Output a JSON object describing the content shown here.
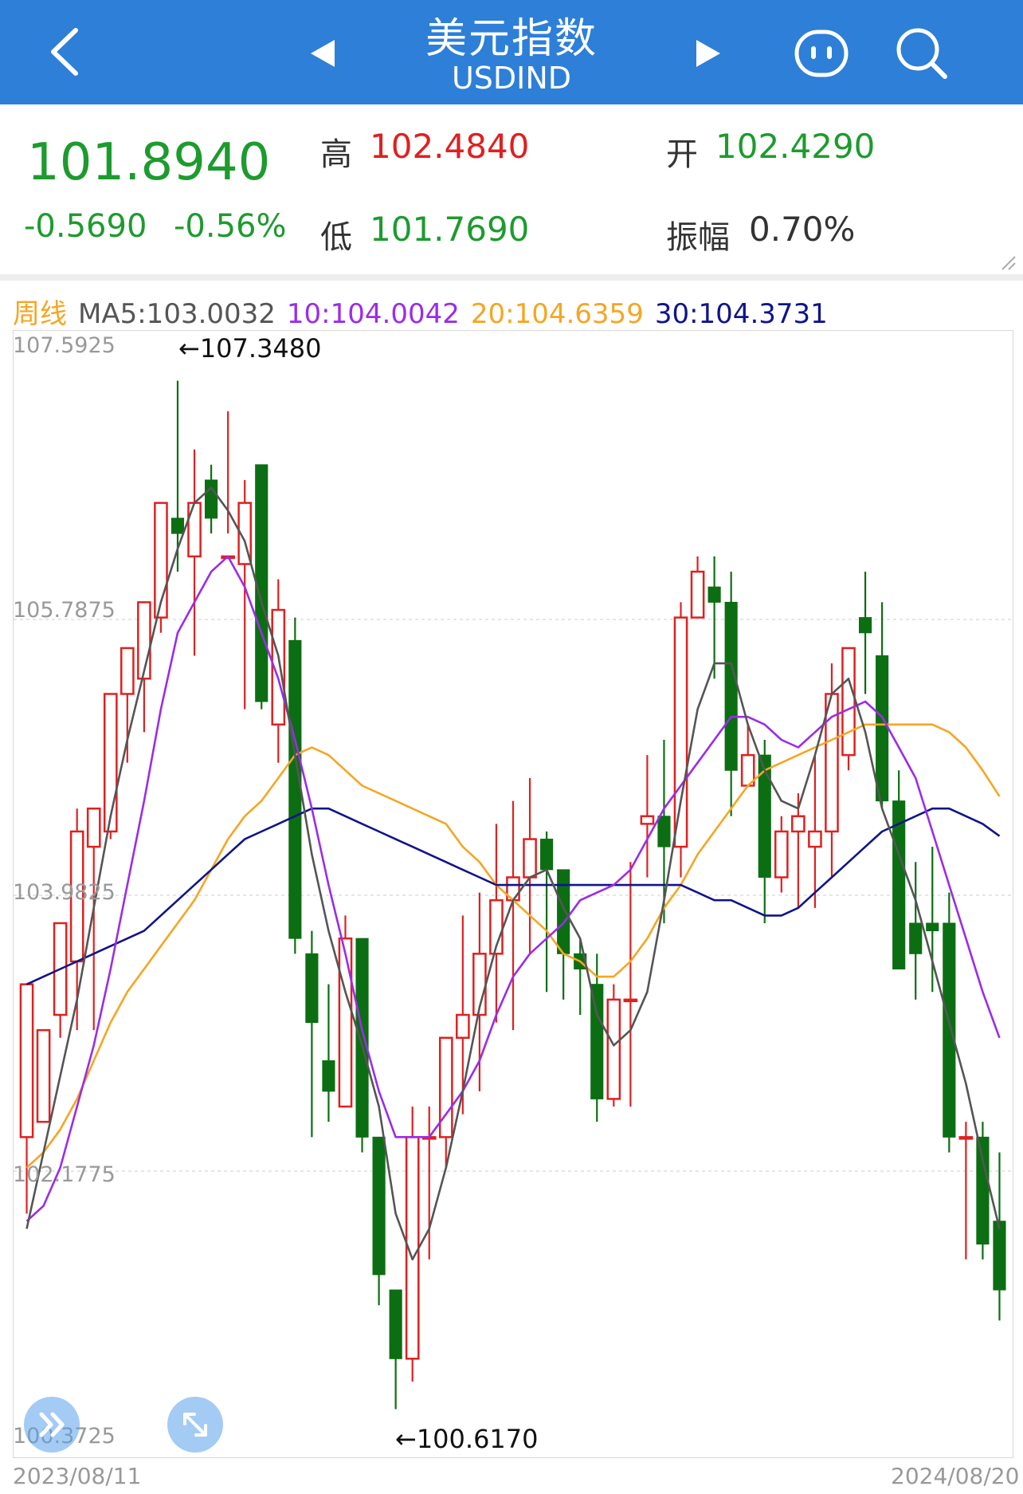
{
  "header": {
    "title": "美元指数",
    "symbol": "USDIND",
    "back_icon": "back-arrow-icon",
    "prev_icon": "triangle-left-icon",
    "next_icon": "triangle-right-icon",
    "assistant_icon": "robot-face-icon",
    "search_icon": "search-icon"
  },
  "quote": {
    "price": "101.8940",
    "change": "-0.5690",
    "change_pct": "-0.56%",
    "high_label": "高",
    "high": "102.4840",
    "open_label": "开",
    "open": "102.4290",
    "low_label": "低",
    "low": "101.7690",
    "amp_label": "振幅",
    "amp": "0.70%"
  },
  "legend": {
    "period": "周线",
    "ma5": "MA5:103.0032",
    "ma10": "10:104.0042",
    "ma20": "20:104.6359",
    "ma30": "30:104.3731"
  },
  "colors": {
    "up": "#e02020",
    "down": "#0c6e12",
    "accent": "#2d7fd8",
    "ma5": "#555555",
    "ma10": "#9b2ce8",
    "ma20": "#f5a623",
    "ma30": "#10148a",
    "neutral_green": "#1d9b2e"
  },
  "chart_data": {
    "type": "candlestick",
    "y_ticks": [
      "107.5925",
      "105.7875",
      "103.9825",
      "102.1775",
      "100.3725"
    ],
    "ylim": [
      100.3725,
      107.5925
    ],
    "max_label": "←107.3480",
    "min_label": "←100.6170",
    "x_start": "2023/08/11",
    "x_end": "2024/08/20",
    "candles": [
      [
        102.4,
        103.4,
        101.9,
        103.4
      ],
      [
        102.5,
        103.1,
        102.5,
        103.1
      ],
      [
        103.2,
        103.8,
        103.05,
        103.55
      ],
      [
        103.55,
        104.4,
        103.1,
        104.55
      ],
      [
        104.3,
        104.55,
        103.1,
        104.4
      ],
      [
        104.4,
        105.3,
        104.35,
        105.2
      ],
      [
        105.3,
        105.6,
        104.85,
        105.55
      ],
      [
        105.4,
        105.9,
        105.05,
        105.8
      ],
      [
        105.8,
        106.55,
        105.7,
        106.45
      ],
      [
        106.45,
        106.35,
        106.1,
        107.35
      ],
      [
        106.2,
        106.55,
        105.55,
        106.9
      ],
      [
        106.7,
        106.45,
        106.35,
        106.8
      ],
      [
        106.2,
        106.2,
        106.35,
        107.15
      ],
      [
        106.15,
        106.55,
        105.2,
        106.7
      ],
      [
        106.8,
        105.25,
        105.2,
        106.45
      ],
      [
        105.1,
        105.85,
        104.85,
        106.05
      ],
      [
        105.65,
        103.7,
        103.6,
        105.8
      ],
      [
        103.6,
        103.15,
        102.4,
        103.75
      ],
      [
        102.9,
        102.7,
        102.5,
        103.4
      ],
      [
        102.6,
        103.7,
        102.6,
        103.85
      ],
      [
        103.7,
        102.4,
        102.3,
        103.7
      ],
      [
        102.4,
        101.5,
        101.3,
        102.4
      ],
      [
        101.4,
        100.95,
        100.62,
        101.4
      ],
      [
        100.95,
        102.4,
        100.8,
        102.6
      ],
      [
        102.4,
        102.4,
        101.6,
        102.6
      ],
      [
        102.4,
        103.05,
        102.2,
        103.05
      ],
      [
        103.05,
        103.2,
        102.55,
        103.85
      ],
      [
        103.2,
        103.6,
        102.7,
        104.0
      ],
      [
        103.6,
        103.95,
        103.15,
        104.45
      ],
      [
        103.95,
        104.1,
        103.1,
        104.6
      ],
      [
        104.1,
        104.35,
        103.6,
        104.75
      ],
      [
        104.35,
        104.15,
        103.35,
        104.4
      ],
      [
        104.15,
        103.6,
        103.3,
        104.15
      ],
      [
        103.6,
        103.5,
        103.2,
        103.7
      ],
      [
        103.4,
        102.65,
        102.5,
        103.6
      ],
      [
        102.65,
        103.3,
        102.6,
        103.4
      ],
      [
        103.3,
        103.3,
        102.6,
        104.2
      ],
      [
        104.45,
        104.5,
        104.1,
        104.9
      ],
      [
        104.5,
        104.3,
        103.8,
        105.0
      ],
      [
        104.3,
        105.8,
        104.1,
        105.9
      ],
      [
        105.8,
        106.1,
        105.8,
        106.2
      ],
      [
        106.0,
        105.9,
        105.4,
        106.2
      ],
      [
        105.9,
        104.8,
        104.5,
        106.1
      ],
      [
        104.7,
        104.9,
        104.7,
        105.1
      ],
      [
        104.9,
        104.1,
        103.8,
        105.0
      ],
      [
        104.1,
        104.4,
        104.0,
        104.5
      ],
      [
        104.4,
        104.5,
        103.9,
        104.65
      ],
      [
        104.3,
        104.4,
        103.9,
        104.9
      ],
      [
        104.4,
        105.3,
        104.1,
        105.5
      ],
      [
        104.9,
        105.6,
        104.8,
        105.6
      ],
      [
        105.8,
        105.7,
        105.3,
        106.1
      ],
      [
        105.55,
        104.6,
        104.55,
        105.9
      ],
      [
        104.6,
        103.5,
        103.5,
        104.8
      ],
      [
        103.8,
        103.6,
        103.3,
        104.2
      ],
      [
        103.8,
        103.75,
        103.35,
        104.3
      ],
      [
        103.8,
        102.4,
        102.3,
        104.0
      ],
      [
        102.4,
        102.4,
        101.6,
        102.5
      ],
      [
        102.4,
        101.7,
        101.6,
        102.5
      ],
      [
        101.85,
        101.4,
        101.2,
        102.3
      ]
    ],
    "ma5": [
      101.8,
      102.3,
      102.8,
      103.3,
      103.9,
      104.5,
      105.0,
      105.45,
      105.9,
      106.25,
      106.55,
      106.65,
      106.5,
      106.3,
      105.9,
      105.55,
      104.9,
      104.25,
      103.75,
      103.35,
      103.0,
      102.6,
      101.9,
      101.6,
      101.8,
      102.2,
      102.7,
      103.25,
      103.65,
      103.95,
      104.1,
      104.15,
      103.9,
      103.7,
      103.2,
      103.0,
      103.1,
      103.35,
      103.95,
      104.6,
      105.2,
      105.5,
      105.5,
      105.1,
      104.8,
      104.6,
      104.55,
      104.9,
      105.3,
      105.4,
      105.05,
      104.55,
      104.25,
      103.95,
      103.55,
      103.15,
      102.75,
      102.25,
      101.8
    ],
    "ma10": [
      101.85,
      101.95,
      102.2,
      102.6,
      103.0,
      103.5,
      104.05,
      104.6,
      105.2,
      105.7,
      105.9,
      106.1,
      106.2,
      106.0,
      105.7,
      105.4,
      105.0,
      104.55,
      104.05,
      103.6,
      103.1,
      102.7,
      102.4,
      102.4,
      102.4,
      102.55,
      102.7,
      102.9,
      103.2,
      103.45,
      103.6,
      103.7,
      103.8,
      103.95,
      104.0,
      104.05,
      104.15,
      104.35,
      104.55,
      104.7,
      104.85,
      105.0,
      105.15,
      105.15,
      105.1,
      105.0,
      104.95,
      105.05,
      105.15,
      105.2,
      105.25,
      105.15,
      104.95,
      104.75,
      104.4,
      104.05,
      103.7,
      103.35,
      103.05
    ],
    "ma20": [
      102.2,
      102.3,
      102.45,
      102.65,
      102.9,
      103.15,
      103.35,
      103.5,
      103.65,
      103.8,
      103.95,
      104.15,
      104.35,
      104.5,
      104.6,
      104.75,
      104.9,
      104.95,
      104.9,
      104.8,
      104.7,
      104.65,
      104.6,
      104.55,
      104.5,
      104.45,
      104.3,
      104.2,
      104.05,
      103.95,
      103.85,
      103.75,
      103.6,
      103.55,
      103.45,
      103.45,
      103.55,
      103.7,
      103.9,
      104.05,
      104.25,
      104.4,
      104.55,
      104.7,
      104.8,
      104.85,
      104.9,
      104.95,
      105.0,
      105.05,
      105.1,
      105.1,
      105.1,
      105.1,
      105.1,
      105.05,
      104.95,
      104.8,
      104.63
    ],
    "ma30": [
      103.4,
      103.45,
      103.5,
      103.55,
      103.6,
      103.65,
      103.7,
      103.75,
      103.85,
      103.95,
      104.05,
      104.15,
      104.25,
      104.35,
      104.4,
      104.45,
      104.5,
      104.55,
      104.55,
      104.5,
      104.45,
      104.4,
      104.35,
      104.3,
      104.25,
      104.2,
      104.15,
      104.1,
      104.05,
      104.05,
      104.05,
      104.05,
      104.05,
      104.05,
      104.05,
      104.05,
      104.05,
      104.05,
      104.05,
      104.05,
      104.0,
      103.95,
      103.95,
      103.9,
      103.85,
      103.85,
      103.9,
      104.0,
      104.1,
      104.2,
      104.3,
      104.4,
      104.45,
      104.5,
      104.55,
      104.55,
      104.5,
      104.45,
      104.37
    ]
  }
}
